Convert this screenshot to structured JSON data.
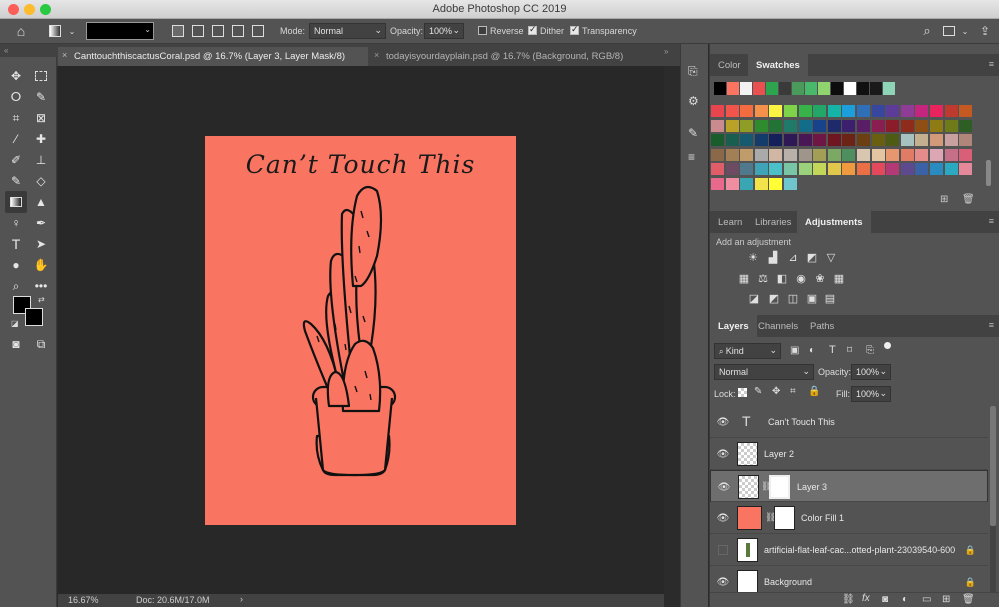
{
  "window": {
    "title": "Adobe Photoshop CC 2019"
  },
  "options_bar": {
    "mode_label": "Mode:",
    "mode_value": "Normal",
    "opacity_label": "Opacity:",
    "opacity_value": "100%",
    "reverse_label": "Reverse",
    "reverse_checked": false,
    "dither_label": "Dither",
    "dither_checked": true,
    "transparency_label": "Transparency",
    "transparency_checked": true
  },
  "doc_tabs": [
    {
      "label": "CanttouchthiscactusCoral.psd @ 16.7% (Layer 3, Layer Mask/8)",
      "active": true
    },
    {
      "label": "todayisyourdayplain.psd @ 16.7% (Background, RGB/8)",
      "active": false
    }
  ],
  "canvas": {
    "background": "#f97561",
    "heading": "Can’t Touch This"
  },
  "status": {
    "zoom": "16.67%",
    "doc": "Doc: 20.6M/17.0M"
  },
  "swatches_panel": {
    "tabs": [
      "Color",
      "Swatches"
    ],
    "active_tab": "Swatches",
    "recent": [
      "#000000",
      "#f97561",
      "#f2f2f2",
      "#e8514f",
      "#2ea44f",
      "#3a3a3a",
      "#4a9a5c",
      "#48b86a",
      "#8fd46f",
      "#0d0d0d",
      "#ffffff",
      "#111111",
      "#1a1a1a",
      "#8ed4b6"
    ],
    "grid": [
      [
        "#e9454e",
        "#f0544a",
        "#f36b3f",
        "#f5914a",
        "#fdf343",
        "#7ed348",
        "#37b34a",
        "#23a769",
        "#14b5a6",
        "#1c9edc",
        "#2f6fb8",
        "#37469e",
        "#5d3c99",
        "#8f3c97",
        "#c4257f",
        "#e8235e",
        "#be3a2f",
        "#c45a21"
      ],
      [
        "#c98b8d",
        "#b9a227",
        "#8e9d25",
        "#2e8c2f",
        "#237335",
        "#1f7a6a",
        "#126d8b",
        "#16438a",
        "#1f2a6b",
        "#3c1f6d",
        "#5a1e66",
        "#8b1e50",
        "#8b1d2a",
        "#8e2b1a",
        "#8f4f14",
        "#8e7b13",
        "#6f7a18",
        "#2d5f25"
      ],
      [
        "#1a5d2d",
        "#1a5e50",
        "#165a70",
        "#133c6a",
        "#14205a",
        "#2e1856",
        "#4a1756",
        "#6e1744",
        "#6f1620",
        "#6b2315",
        "#6b3f12",
        "#6a5f10",
        "#4e5b14",
        "#a7c1c0",
        "#c4b08e",
        "#d39a7a",
        "#c9a0a0",
        "#b0857a"
      ],
      [
        "#8a6848",
        "#a37f56",
        "#bf9c6a",
        "#aaaaaa",
        "#d1b6a3",
        "#b8b0a9",
        "#9f958b",
        "#a29e55",
        "#7ba862",
        "#4f8f5f",
        "#d8c6b0",
        "#e3c6a1",
        "#e79770",
        "#e07b65",
        "#e58b89",
        "#dca6b5",
        "#c56f89",
        "#d95f78"
      ],
      [
        "#e25d6a",
        "#6d4b63",
        "#50798e",
        "#3fa4b7",
        "#4cc0c8",
        "#78c6a5",
        "#9ad17a",
        "#c2d65a",
        "#e1c84a",
        "#ef9a3f",
        "#ea6f44",
        "#e3495c",
        "#b43a76",
        "#5d4a8e",
        "#3b62a6",
        "#2a8bc0",
        "#2aa9c1",
        "#e4899a"
      ],
      [
        "#e9698c",
        "#ef8ea0",
        "#3aa6b4",
        "#f3e34a",
        "#ffff33",
        "#6fc6cf"
      ]
    ]
  },
  "adjustments_panel": {
    "tabs": [
      "Learn",
      "Libraries",
      "Adjustments"
    ],
    "active_tab": "Adjustments",
    "hint": "Add an adjustment"
  },
  "layers_panel": {
    "tabs": [
      "Layers",
      "Channels",
      "Paths"
    ],
    "active_tab": "Layers",
    "filter_kind": "Kind",
    "blend_mode": "Normal",
    "opacity_label": "Opacity:",
    "opacity_value": "100%",
    "lock_label": "Lock:",
    "fill_label": "Fill:",
    "fill_value": "100%",
    "layers": [
      {
        "name": "Can’t Touch This",
        "type": "text",
        "visible": true,
        "selected": false,
        "locked": false
      },
      {
        "name": "Layer 2",
        "type": "pixel",
        "visible": true,
        "selected": false,
        "locked": false
      },
      {
        "name": "Layer 3",
        "type": "masked",
        "visible": true,
        "selected": true,
        "locked": false
      },
      {
        "name": "Color Fill 1",
        "type": "fill",
        "visible": true,
        "selected": false,
        "locked": false,
        "color": "#f97561"
      },
      {
        "name": "artificial-flat-leaf-cac...otted-plant-23039540-600",
        "type": "image",
        "visible": false,
        "selected": false,
        "locked": true
      },
      {
        "name": "Background",
        "type": "background",
        "visible": true,
        "selected": false,
        "locked": true
      }
    ]
  }
}
